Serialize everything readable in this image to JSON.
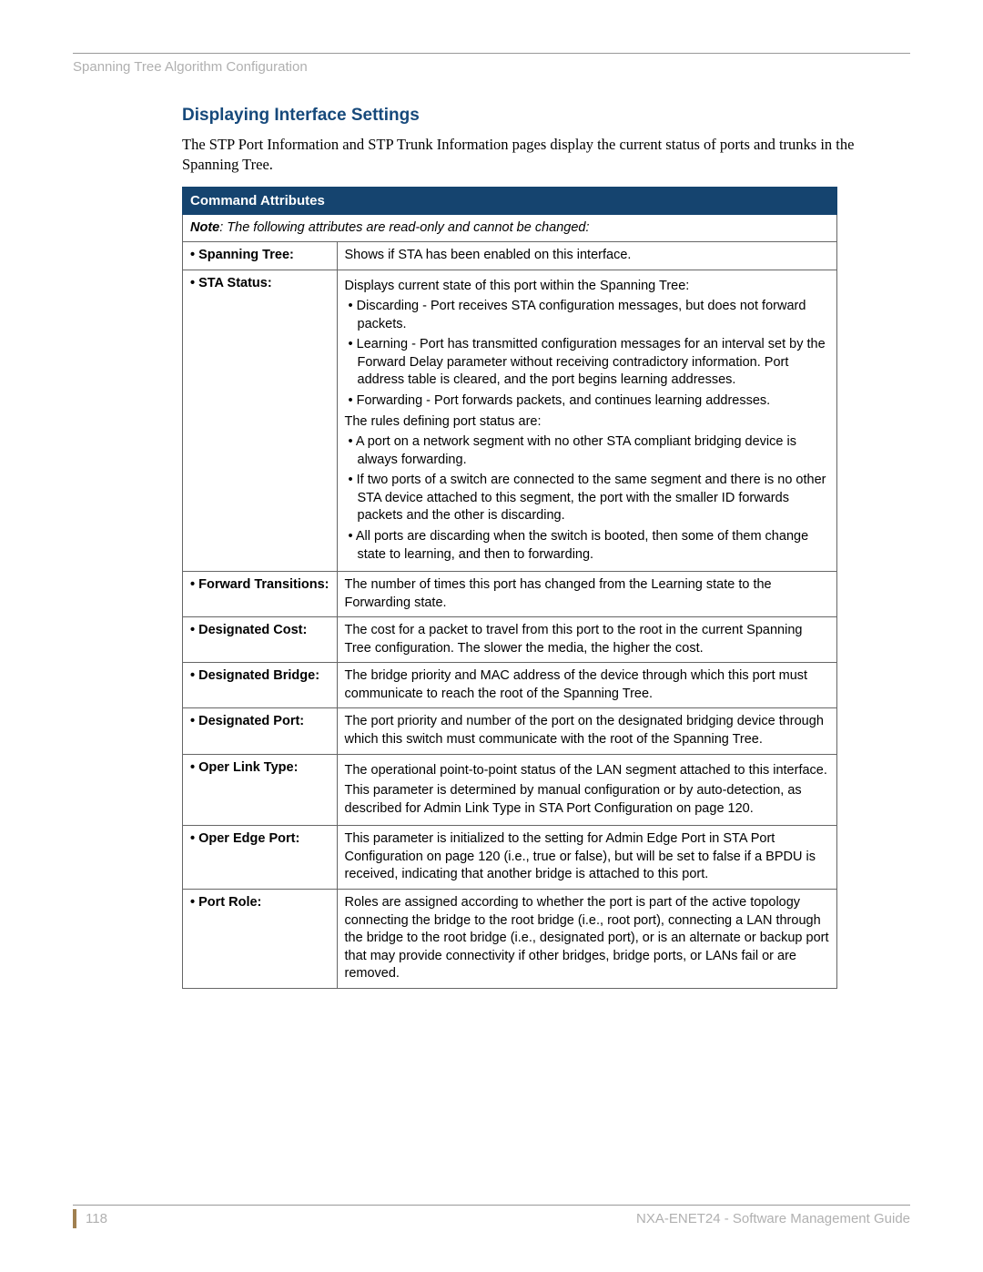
{
  "header": {
    "running_head": "Spanning Tree Algorithm Configuration"
  },
  "section": {
    "title": "Displaying Interface Settings",
    "intro": "The STP Port Information and STP Trunk Information pages display the current status of ports and trunks in the Spanning Tree."
  },
  "table": {
    "header": "Command Attributes",
    "note_label": "Note",
    "note_body": ": The following attributes are read-only and cannot be changed:",
    "rows": {
      "spanning_tree": {
        "label": "• Spanning Tree:",
        "desc": "Shows if STA has been enabled on this interface."
      },
      "sta_status": {
        "label": "• STA Status:",
        "intro": "Displays current state of this port within the Spanning Tree:",
        "b1": "Discarding - Port receives STA configuration messages, but does not forward packets.",
        "b2": "Learning - Port has transmitted configuration messages for an interval set by the Forward Delay parameter without receiving contradictory information. Port address table is cleared, and the port begins learning addresses.",
        "b3": "Forwarding - Port forwards packets, and continues learning addresses.",
        "rules": "The rules defining port status are:",
        "r1": "A port on a network segment with no other STA compliant bridging device is always forwarding.",
        "r2": "If two ports of a switch are connected to the same segment and there is no other STA device attached to this segment, the port with the smaller ID forwards packets and the other is discarding.",
        "r3": "All ports are discarding when the switch is booted, then some of them change state to learning, and then to forwarding."
      },
      "forward_transitions": {
        "label": "• Forward Transitions:",
        "desc": "The number of times this port has changed from the Learning state to the Forwarding state."
      },
      "designated_cost": {
        "label": "• Designated Cost:",
        "desc": "The cost for a packet to travel from this port to the root in the current Spanning Tree configuration. The slower the media, the higher the cost."
      },
      "designated_bridge": {
        "label": "• Designated Bridge:",
        "desc": "The bridge priority and MAC address of the device through which this port must communicate to reach the root of the Spanning Tree."
      },
      "designated_port": {
        "label": "• Designated Port:",
        "desc": "The port priority and number of the port on the designated bridging device through which this switch must communicate with the root of the Spanning Tree."
      },
      "oper_link_type": {
        "label": "• Oper Link Type:",
        "d1": "The operational point-to-point status of the LAN segment attached to this interface.",
        "d2": "This parameter is determined by manual configuration or by auto-detection, as described for Admin Link Type in STA Port Configuration on page 120."
      },
      "oper_edge_port": {
        "label": "• Oper Edge Port:",
        "desc": "This parameter is initialized to the setting for Admin Edge Port in STA Port Configuration on page 120 (i.e., true or false), but will be set to false if a BPDU is received, indicating that another bridge is attached to this port."
      },
      "port_role": {
        "label": "• Port Role:",
        "desc": "Roles are assigned according to whether the port is part of the active topology connecting the bridge to the root bridge (i.e., root port), connecting a LAN through the bridge to the root bridge (i.e., designated port), or is an alternate or backup port that may provide connectivity if other bridges, bridge ports, or LANs fail or are removed."
      }
    }
  },
  "footer": {
    "page": "118",
    "doc": "NXA-ENET24 - Software Management Guide"
  }
}
